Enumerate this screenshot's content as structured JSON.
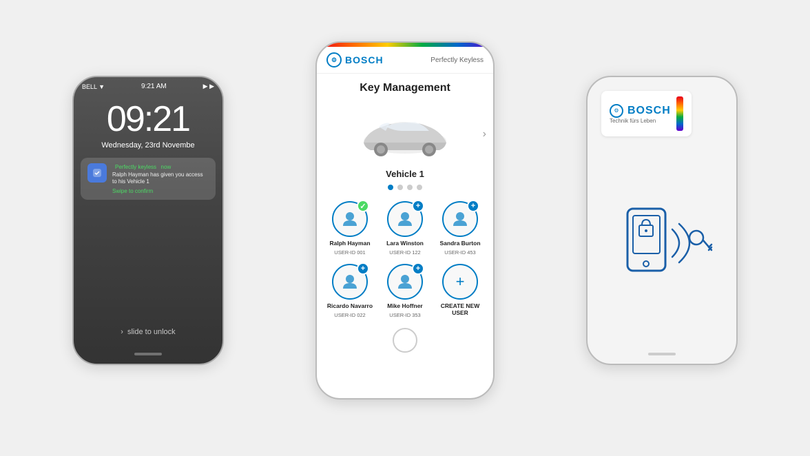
{
  "left_phone": {
    "status_bar": {
      "carrier": "BELL ▼",
      "time": "9:21 AM",
      "icons": "WiFi Battery"
    },
    "time_display": "09:21",
    "date_display": "Wednesday, 23rd Novembe",
    "notification": {
      "app_name": "Perfectly keyless",
      "timestamp": "now",
      "body": "Ralph Hayman has given you access to his Vehicle 1",
      "action": "Swipe to confirm"
    },
    "slide_text": "slide to unlock"
  },
  "center_phone": {
    "header": {
      "brand": "BOSCH",
      "subtitle": "Perfectly Keyless"
    },
    "page_title": "Key Management",
    "vehicle": {
      "name": "Vehicle 1",
      "carousel_dots": [
        true,
        false,
        false,
        false
      ]
    },
    "users": [
      {
        "name": "Ralph Hayman",
        "id": "USER-ID 001",
        "badge": "check"
      },
      {
        "name": "Lara Winston",
        "id": "USER-ID 122",
        "badge": "plus"
      },
      {
        "name": "Sandra Burton",
        "id": "USER-ID 453",
        "badge": "plus"
      },
      {
        "name": "Ricardo Navarro",
        "id": "USER-ID 022",
        "badge": "plus"
      },
      {
        "name": "Mike Hoffner",
        "id": "USER-ID 353",
        "badge": "plus"
      },
      {
        "name": "CREATE NEW USER",
        "id": "",
        "badge": "none"
      }
    ]
  },
  "right_phone": {
    "brand": "BOSCH",
    "tagline": "Technik fürs Leben"
  }
}
